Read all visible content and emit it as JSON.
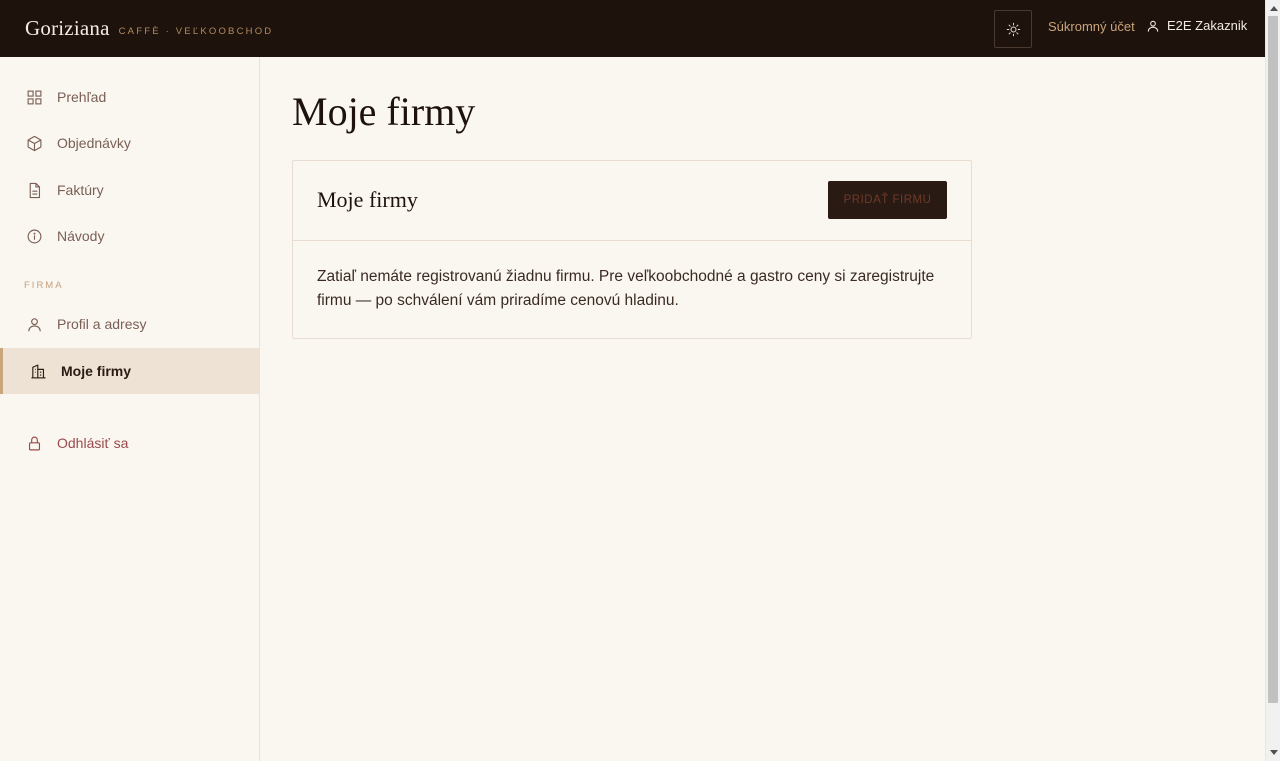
{
  "header": {
    "brand_name": "Goriziana",
    "brand_tagline": "CAFFÈ · VEĽKOOBCHOD",
    "private_account_label": "Súkromný účet",
    "user_name": "E2E Zakaznik"
  },
  "sidebar": {
    "items": [
      {
        "label": "Prehľad",
        "icon": "grid-icon"
      },
      {
        "label": "Objednávky",
        "icon": "box-icon"
      },
      {
        "label": "Faktúry",
        "icon": "document-icon"
      },
      {
        "label": "Návody",
        "icon": "info-icon"
      }
    ],
    "section_label": "FIRMA",
    "firm_items": [
      {
        "label": "Profil a adresy",
        "icon": "user-icon"
      },
      {
        "label": "Moje firmy",
        "icon": "building-icon",
        "active": true
      }
    ],
    "logout_label": "Odhlásiť sa"
  },
  "main": {
    "page_title": "Moje firmy",
    "card": {
      "title": "Moje firmy",
      "add_button_label": "PRIDAŤ FIRMU",
      "empty_message": "Zatiaľ nemáte registrovanú žiadnu firmu. Pre veľkoobchodné a gastro ceny si zaregistrujte firmu — po schválení vám priradíme cenovú hladinu."
    }
  },
  "colors": {
    "header_bg": "#1e120d",
    "page_bg": "#faf7f1",
    "accent_gold": "#c9a57b",
    "active_item_bg": "#ede2d3",
    "logout_red": "#9a4a4a"
  }
}
